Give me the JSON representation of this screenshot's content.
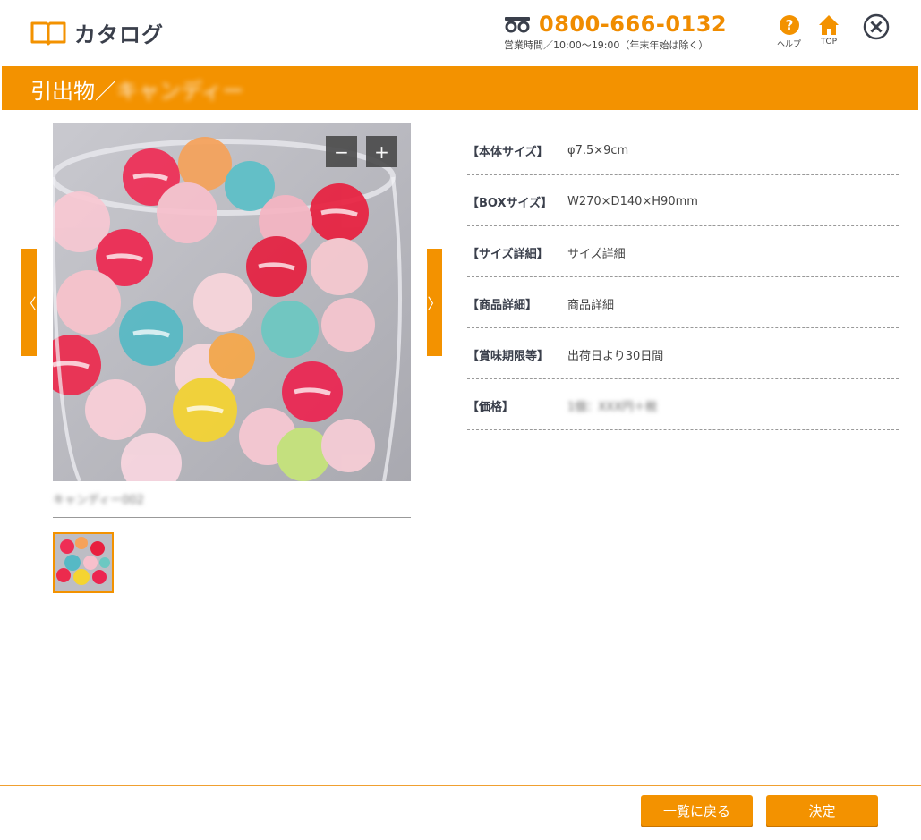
{
  "header": {
    "app_title": "カタログ",
    "phone_number": "0800-666-0132",
    "business_hours": "営業時間／10:00～19:00（年末年始は除く）",
    "help_label": "ヘルプ",
    "top_label": "TOP"
  },
  "titlebar": {
    "category": "引出物／",
    "item_name": "キャンディー"
  },
  "image": {
    "zoom_out": "−",
    "zoom_in": "+",
    "prev": "〈",
    "next": "〉",
    "caption": "キャンディー002"
  },
  "specs": [
    {
      "label": "【本体サイズ】",
      "value": "φ7.5×9cm"
    },
    {
      "label": "【BOXサイズ】",
      "value": "W270×D140×H90mm"
    },
    {
      "label": "【サイズ詳細】",
      "value": "サイズ詳細"
    },
    {
      "label": "【商品詳細】",
      "value": "商品詳細"
    },
    {
      "label": "【賞味期限等】",
      "value": "出荷日より30日間"
    },
    {
      "label": "【価格】",
      "value": "1個：XXX円＋税"
    }
  ],
  "footer": {
    "back_label": "一覧に戻る",
    "ok_label": "決定"
  },
  "colors": {
    "accent": "#f39200",
    "text_dark": "#3a3f4b"
  }
}
